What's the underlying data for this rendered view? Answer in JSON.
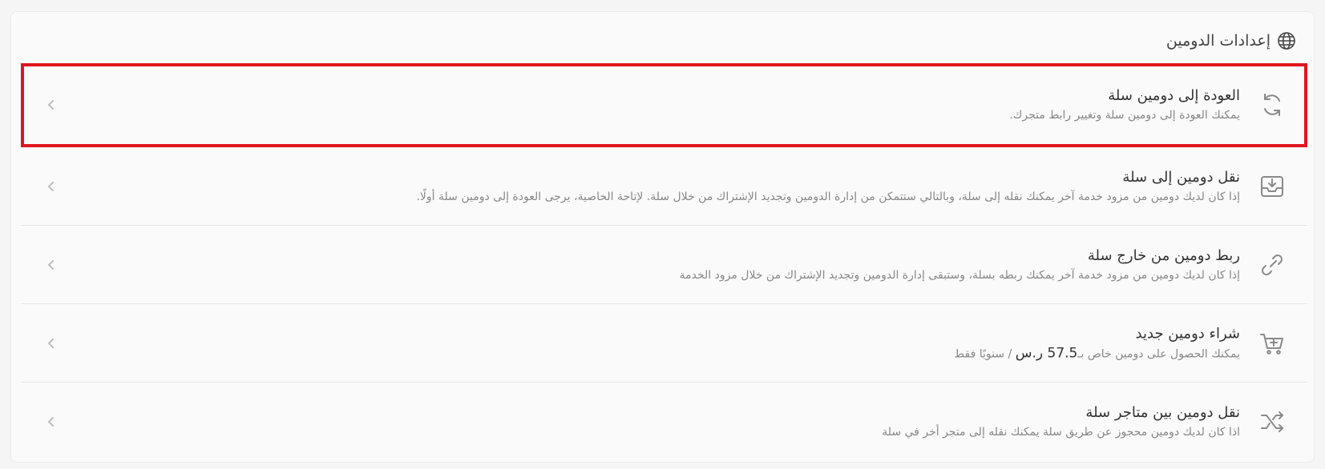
{
  "header": {
    "title": "إعدادات الدومين",
    "icon": "globe-icon"
  },
  "rows": [
    {
      "title": "العودة إلى دومين سلة",
      "desc": "يمكنك العودة إلى دومين سلة وتغيير رابط متجرك.",
      "icon": "refresh-icon",
      "selected": true
    },
    {
      "title": "نقل دومين إلى سلة",
      "desc": "إذا كان لديك دومين من مزود خدمة آخر يمكنك نقله إلى سلة، وبالتالي ستتمكن من إدارة الدومين وتجديد الإشتراك من خلال سلة. لإتاحة الخاصية، يرجى العودة إلى دومين سلة أولًا.",
      "icon": "inbox-download-icon"
    },
    {
      "title": "ربط دومين من خارج سلة",
      "desc": "إذا كان لديك دومين من مزود خدمة آخر يمكنك ربطه بسلة، وستبقى إدارة الدومين وتجديد الإشتراك من خلال مزود الخدمة",
      "icon": "link-icon"
    },
    {
      "title": "شراء دومين جديد",
      "desc_prefix": "يمكنك الحصول على دومين خاص بـ",
      "price": "57.5 ر.س",
      "desc_suffix": " / سنويًا فقط",
      "icon": "cart-plus-icon"
    },
    {
      "title": "نقل دومين بين متاجر سلة",
      "desc": "اذا كان لديك دومين محجوز عن طريق سلة يمكنك نقله إلى متجر أخر في سلة",
      "icon": "shuffle-icon"
    }
  ],
  "colors": {
    "highlight": "#e0161e",
    "icon": "#8a8a8a",
    "chevron": "#bdbdbd"
  }
}
